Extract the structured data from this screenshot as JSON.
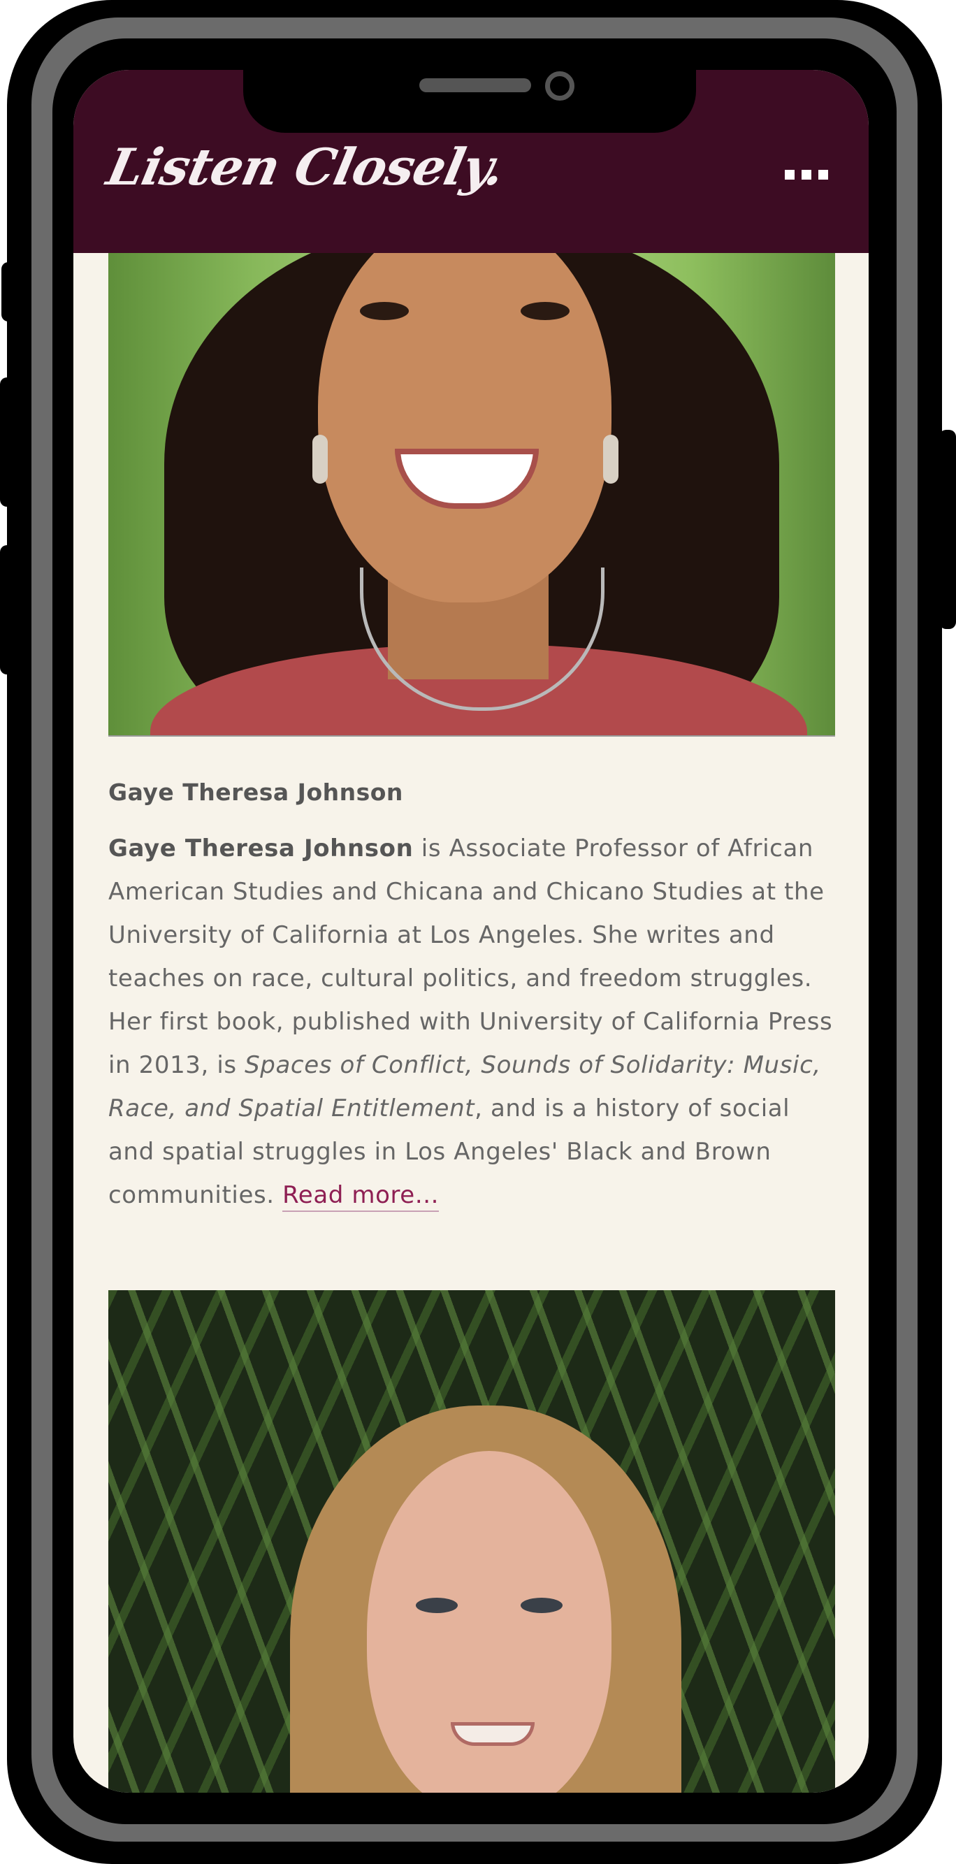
{
  "header": {
    "logo_text": "Listen Closely.",
    "background_color": "#3d0c23",
    "menu_icon": "more-dots-icon"
  },
  "profile1": {
    "photo_alt": "Gaye Theresa Johnson",
    "name": "Gaye Theresa Johnson",
    "bio_name": "Gaye Theresa Johnson",
    "bio_part1": " is Associate Professor of African American Studies and Chicana and Chicano Studies at the University of California at Los Angeles. She writes and teaches on race, cultural politics, and freedom struggles. Her first book, published with University of California Press in 2013, is ",
    "book_title": "Spaces of Conflict, Sounds of Solidarity: Music, Race, and Spatial Entitlement",
    "bio_part2": ", and is a history of social and spatial struggles in Los Angeles' Black and Brown communities. ",
    "read_more": "Read more..."
  },
  "profile2": {
    "photo_alt": ""
  },
  "colors": {
    "accent": "#8e1f53",
    "page_background": "#f7f3ea",
    "text": "#666666"
  }
}
